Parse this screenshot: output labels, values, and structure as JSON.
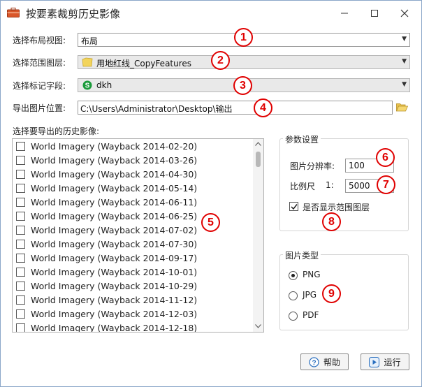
{
  "window": {
    "title": "按要素裁剪历史影像"
  },
  "form": {
    "layout_view_label": "选择布局视图:",
    "layout_view_value": "布局",
    "range_layer_label": "选择范围图层:",
    "range_layer_value": "用地红线_CopyFeatures",
    "mark_field_label": "选择标记字段:",
    "mark_field_value": "dkh",
    "export_path_label": "导出图片位置:",
    "export_path_value": "C:\\Users\\Administrator\\Desktop\\输出",
    "history_label": "选择要导出的历史影像:"
  },
  "imagery_list": [
    "World Imagery (Wayback 2014-02-20)",
    "World Imagery (Wayback 2014-03-26)",
    "World Imagery (Wayback 2014-04-30)",
    "World Imagery (Wayback 2014-05-14)",
    "World Imagery (Wayback 2014-06-11)",
    "World Imagery (Wayback 2014-06-25)",
    "World Imagery (Wayback 2014-07-02)",
    "World Imagery (Wayback 2014-07-30)",
    "World Imagery (Wayback 2014-09-17)",
    "World Imagery (Wayback 2014-10-01)",
    "World Imagery (Wayback 2014-10-29)",
    "World Imagery (Wayback 2014-11-12)",
    "World Imagery (Wayback 2014-12-03)",
    "World Imagery (Wayback 2014-12-18)"
  ],
  "params": {
    "title": "参数设置",
    "resolution_label": "图片分辨率:",
    "resolution_value": "100",
    "scale_label": "比例尺",
    "scale_prefix": "1:",
    "scale_value": "5000",
    "show_range_label": "是否显示范围图层",
    "show_range_checked": true
  },
  "image_type": {
    "title": "图片类型",
    "options": [
      "PNG",
      "JPG",
      "PDF"
    ],
    "selected": "PNG"
  },
  "buttons": {
    "help": "帮助",
    "run": "运行"
  },
  "annotations": [
    "1",
    "2",
    "3",
    "4",
    "5",
    "6",
    "7",
    "8",
    "9"
  ],
  "colors": {
    "annotation_red": "#e00000",
    "field_icon_green": "#1a9a3a",
    "folder_yellow": "#f2d45c",
    "button_icon_blue": "#2a6fbf"
  }
}
